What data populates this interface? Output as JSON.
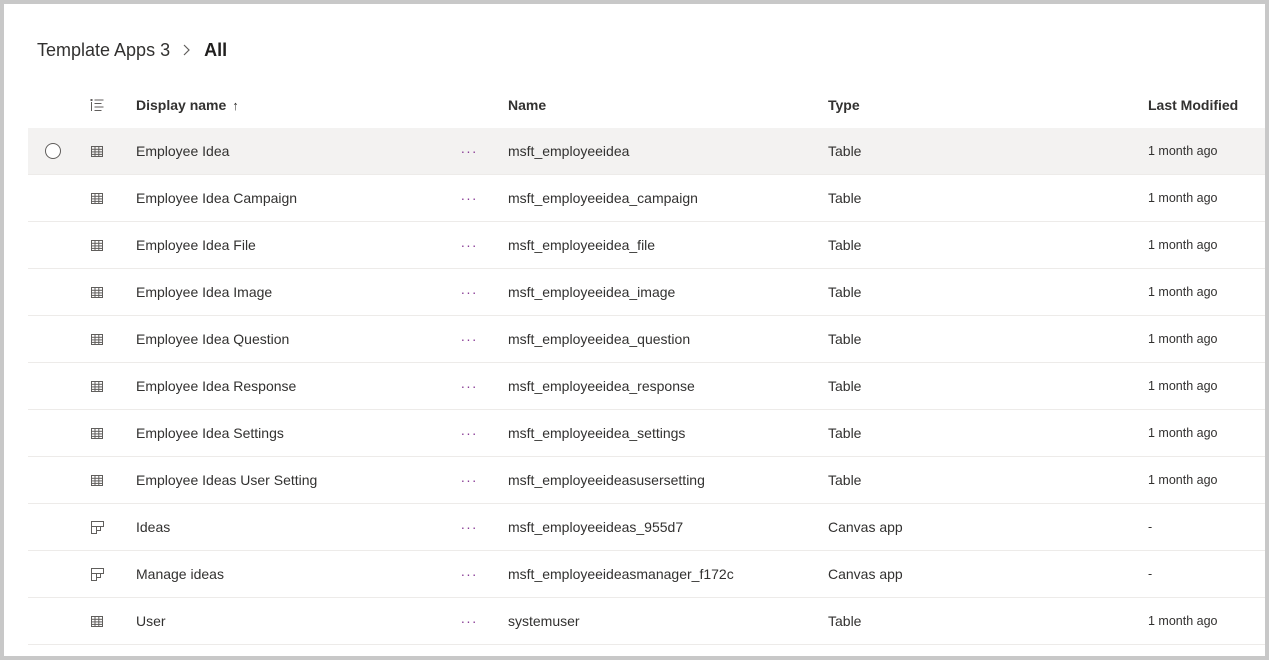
{
  "breadcrumb": {
    "root": "Template Apps 3",
    "current": "All",
    "separator_icon": "chevron-right-icon"
  },
  "columns": {
    "list_icon": "list-view-icon",
    "display_name": "Display name",
    "sort_indicator": "↑",
    "name": "Name",
    "type": "Type",
    "last_modified": "Last Modified"
  },
  "rows": [
    {
      "display": "Employee Idea",
      "name": "msft_employeeidea",
      "type": "Table",
      "modified": "1 month ago",
      "icon": "table-icon",
      "hovered": true
    },
    {
      "display": "Employee Idea Campaign",
      "name": "msft_employeeidea_campaign",
      "type": "Table",
      "modified": "1 month ago",
      "icon": "table-icon"
    },
    {
      "display": "Employee Idea File",
      "name": "msft_employeeidea_file",
      "type": "Table",
      "modified": "1 month ago",
      "icon": "table-icon"
    },
    {
      "display": "Employee Idea Image",
      "name": "msft_employeeidea_image",
      "type": "Table",
      "modified": "1 month ago",
      "icon": "table-icon"
    },
    {
      "display": "Employee Idea Question",
      "name": "msft_employeeidea_question",
      "type": "Table",
      "modified": "1 month ago",
      "icon": "table-icon"
    },
    {
      "display": "Employee Idea Response",
      "name": "msft_employeeidea_response",
      "type": "Table",
      "modified": "1 month ago",
      "icon": "table-icon"
    },
    {
      "display": "Employee Idea Settings",
      "name": "msft_employeeidea_settings",
      "type": "Table",
      "modified": "1 month ago",
      "icon": "table-icon"
    },
    {
      "display": "Employee Ideas User Setting",
      "name": "msft_employeeideasusersetting",
      "type": "Table",
      "modified": "1 month ago",
      "icon": "table-icon"
    },
    {
      "display": "Ideas",
      "name": "msft_employeeideas_955d7",
      "type": "Canvas app",
      "modified": "-",
      "icon": "canvas-app-icon"
    },
    {
      "display": "Manage ideas",
      "name": "msft_employeeideasmanager_f172c",
      "type": "Canvas app",
      "modified": "-",
      "icon": "canvas-app-icon"
    },
    {
      "display": "User",
      "name": "systemuser",
      "type": "Table",
      "modified": "1 month ago",
      "icon": "table-icon"
    }
  ],
  "more_label": "···",
  "colors": {
    "accent_dots": "#8a3c96",
    "hover_row": "#f3f2f1",
    "divider": "#edebe9",
    "frame_border": "#c8c8c8"
  }
}
